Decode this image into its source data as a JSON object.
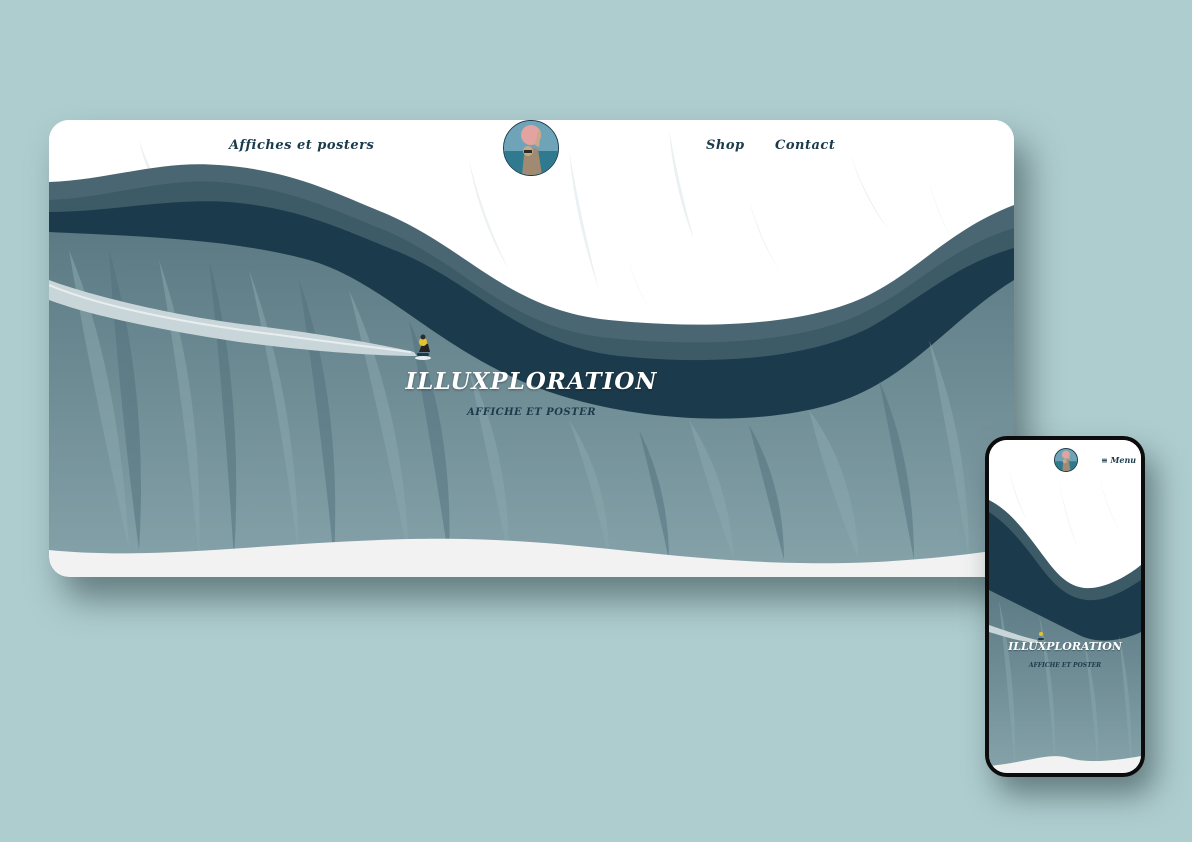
{
  "desktop": {
    "nav": {
      "left_link": "Affiches et posters",
      "shop": "Shop",
      "contact": "Contact"
    },
    "hero": {
      "title": "ILLUXPLORATION",
      "subtitle": "AFFICHE ET POSTER"
    }
  },
  "mobile": {
    "menu_label": "Menu",
    "hero": {
      "title": "ILLUXPLORATION",
      "subtitle": "AFFICHE ET POSTER"
    }
  },
  "colors": {
    "background": "#aecdcf",
    "wave_dark": "#1b3a4b",
    "wave_mid": "#3d5a67",
    "water": "#6f8d96",
    "snow": "#f2f2f2"
  },
  "icons": [
    "logo-avatar",
    "hamburger-menu-icon"
  ]
}
